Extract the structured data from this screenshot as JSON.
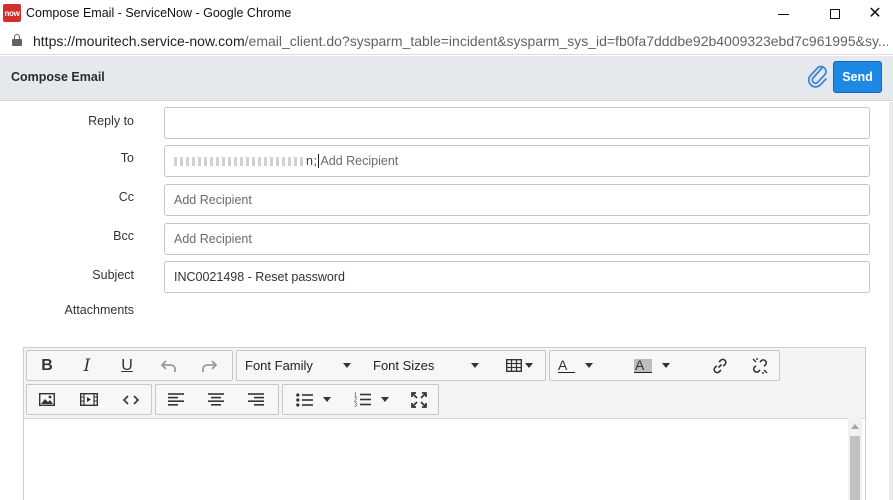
{
  "window": {
    "logo_text": "now",
    "title": "Compose Email - ServiceNow - Google Chrome"
  },
  "address": {
    "host": "https://mouritech.service-now.com",
    "path": "/email_client.do?sysparm_table=incident&sysparm_sys_id=fb0fa7dddbe92b4009323ebd7c961995&sy..."
  },
  "header": {
    "title": "Compose Email",
    "send_label": "Send"
  },
  "form": {
    "reply_to_label": "Reply to",
    "reply_to_value": "",
    "to_label": "To",
    "to_recipient_tail": "n;",
    "add_recipient_placeholder": "Add Recipient",
    "cc_label": "Cc",
    "bcc_label": "Bcc",
    "subject_label": "Subject",
    "subject_value": "INC0021498 - Reset password",
    "attachments_label": "Attachments"
  },
  "toolbar": {
    "bold": "B",
    "italic": "I",
    "underline": "U",
    "font_family": "Font Family",
    "font_sizes": "Font Sizes",
    "text_color": "A",
    "bg_color": "A"
  },
  "colors": {
    "send_button": "#1e88e5",
    "header_bg": "#e5e8ec",
    "logo_red": "#d32f2f"
  }
}
